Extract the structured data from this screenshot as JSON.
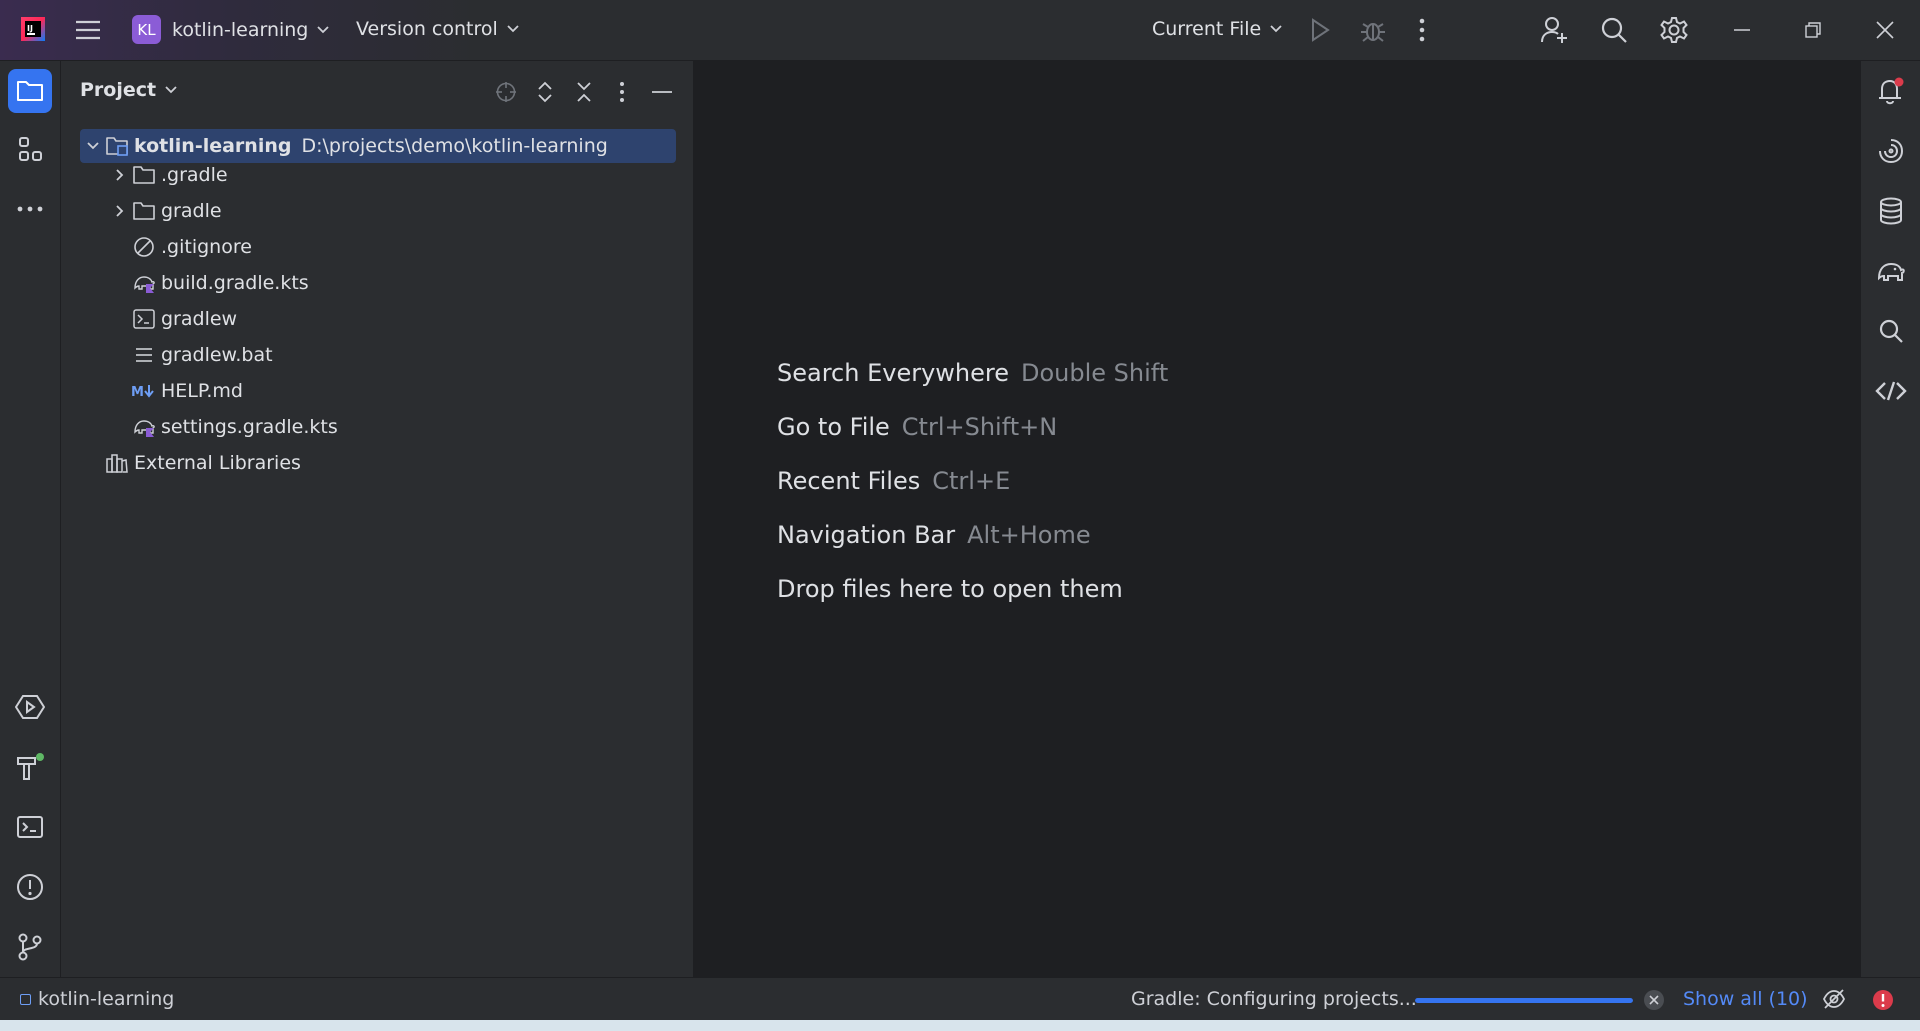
{
  "titlebar": {
    "project_badge": "KL",
    "project_name": "kotlin-learning",
    "vcs_label": "Version control",
    "run_config": "Current File",
    "icons": [
      "intellij-logo-icon",
      "hamburger-menu-icon",
      "run-icon",
      "debug-icon",
      "more-vertical-icon",
      "add-user-icon",
      "search-icon",
      "settings-gear-icon",
      "minimize-icon",
      "restore-icon",
      "close-icon"
    ]
  },
  "left_stripe": {
    "icons": [
      "project-folder-icon",
      "structure-icon",
      "more-horizontal-icon",
      "services-icon",
      "build-icon",
      "terminal-icon",
      "problems-icon",
      "git-branch-icon"
    ]
  },
  "project_panel": {
    "title": "Project",
    "tools": [
      "locate-icon",
      "expand-all-icon",
      "collapse-all-icon",
      "options-icon",
      "hide-icon"
    ],
    "tree": [
      {
        "label": "kotlin-learning",
        "path": "D:\\projects\\demo\\kotlin-learning",
        "icon": "module-folder-icon",
        "expanded": true,
        "selected": true
      },
      {
        "label": ".gradle",
        "icon": "folder-icon",
        "expandable": true
      },
      {
        "label": "gradle",
        "icon": "folder-icon",
        "expandable": true
      },
      {
        "label": ".gitignore",
        "icon": "ignore-file-icon"
      },
      {
        "label": "build.gradle.kts",
        "icon": "gradle-kotlin-icon"
      },
      {
        "label": "gradlew",
        "icon": "shell-script-icon"
      },
      {
        "label": "gradlew.bat",
        "icon": "text-file-icon"
      },
      {
        "label": "HELP.md",
        "icon": "markdown-icon"
      },
      {
        "label": "settings.gradle.kts",
        "icon": "gradle-kotlin-icon"
      },
      {
        "label": "External Libraries",
        "icon": "libraries-icon"
      }
    ]
  },
  "editor": {
    "hints": [
      {
        "action": "Search Everywhere",
        "shortcut": "Double Shift"
      },
      {
        "action": "Go to File",
        "shortcut": "Ctrl+Shift+N"
      },
      {
        "action": "Recent Files",
        "shortcut": "Ctrl+E"
      },
      {
        "action": "Navigation Bar",
        "shortcut": "Alt+Home"
      },
      {
        "action": "Drop files here to open them",
        "shortcut": ""
      }
    ]
  },
  "right_stripe": {
    "icons": [
      "notifications-icon",
      "ai-assistant-icon",
      "database-icon",
      "gradle-elephant-icon",
      "search-icon",
      "code-with-me-icon"
    ]
  },
  "statusbar": {
    "project_name": "kotlin-learning",
    "task": "Gradle: Configuring projects...",
    "progress": 1.0,
    "show_all": "Show all (10)"
  },
  "colors": {
    "accent": "#3574f0",
    "selection": "#2e436e",
    "badge": "#8b5cd6",
    "error": "#db3b4b",
    "success": "#5fb865"
  }
}
